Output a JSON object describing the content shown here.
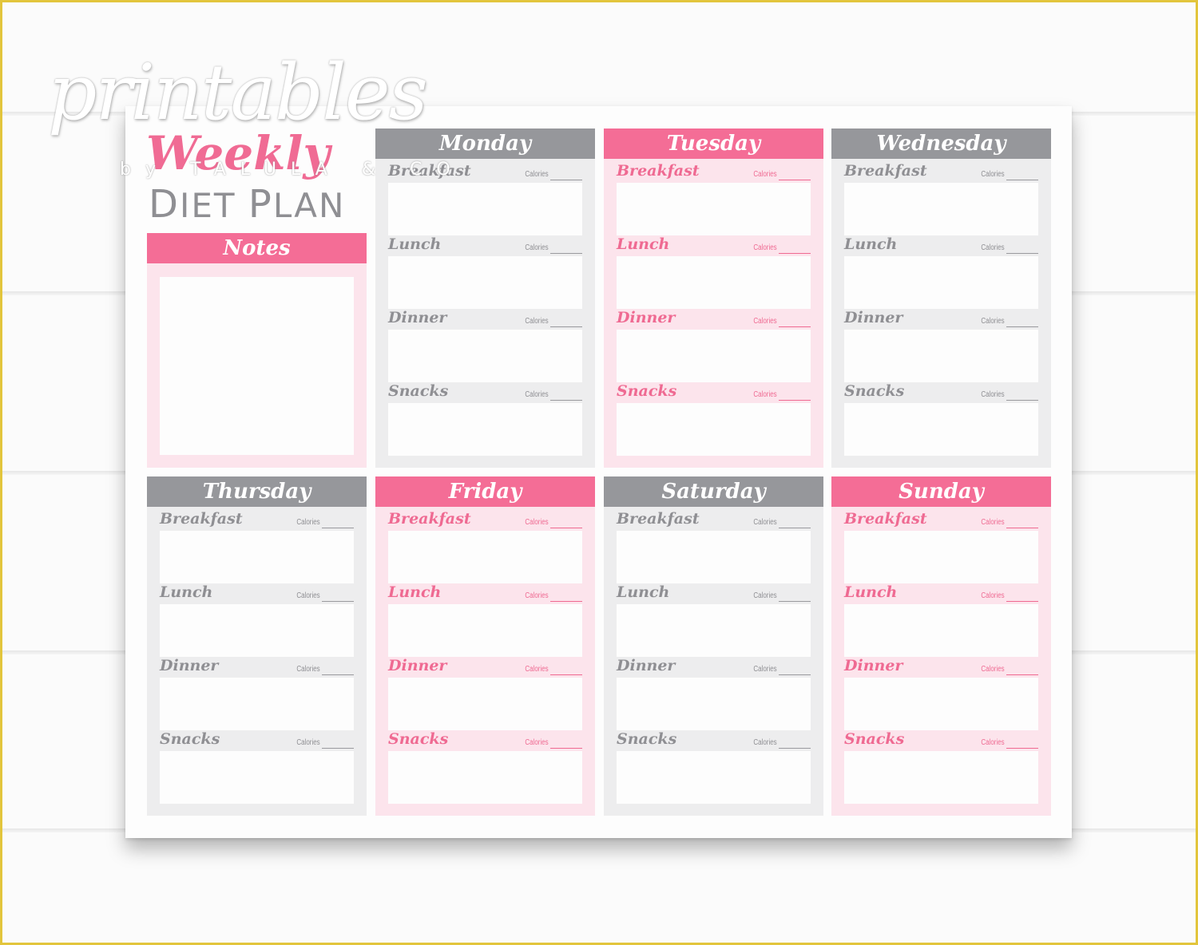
{
  "branding": {
    "printables": "printables",
    "byline": "by TALULA & CO",
    "weekly": "Weekly",
    "diet_plan": "Diet Plan"
  },
  "notes": {
    "title": "Notes"
  },
  "colors": {
    "pink": "#f46d96",
    "pink_light": "#fce4ec",
    "grey": "#96979b",
    "grey_light": "#ededee",
    "border": "#e2c53c"
  },
  "calories_label": "Calories",
  "days": [
    {
      "name": "Monday",
      "theme": "grey",
      "meals": [
        "Breakfast",
        "Lunch",
        "Dinner",
        "Snacks"
      ]
    },
    {
      "name": "Tuesday",
      "theme": "pink",
      "meals": [
        "Breakfast",
        "Lunch",
        "Dinner",
        "Snacks"
      ]
    },
    {
      "name": "Wednesday",
      "theme": "grey",
      "meals": [
        "Breakfast",
        "Lunch",
        "Dinner",
        "Snacks"
      ]
    },
    {
      "name": "Thursday",
      "theme": "grey",
      "meals": [
        "Breakfast",
        "Lunch",
        "Dinner",
        "Snacks"
      ]
    },
    {
      "name": "Friday",
      "theme": "pink",
      "meals": [
        "Breakfast",
        "Lunch",
        "Dinner",
        "Snacks"
      ]
    },
    {
      "name": "Saturday",
      "theme": "grey",
      "meals": [
        "Breakfast",
        "Lunch",
        "Dinner",
        "Snacks"
      ]
    },
    {
      "name": "Sunday",
      "theme": "pink",
      "meals": [
        "Breakfast",
        "Lunch",
        "Dinner",
        "Snacks"
      ]
    }
  ]
}
